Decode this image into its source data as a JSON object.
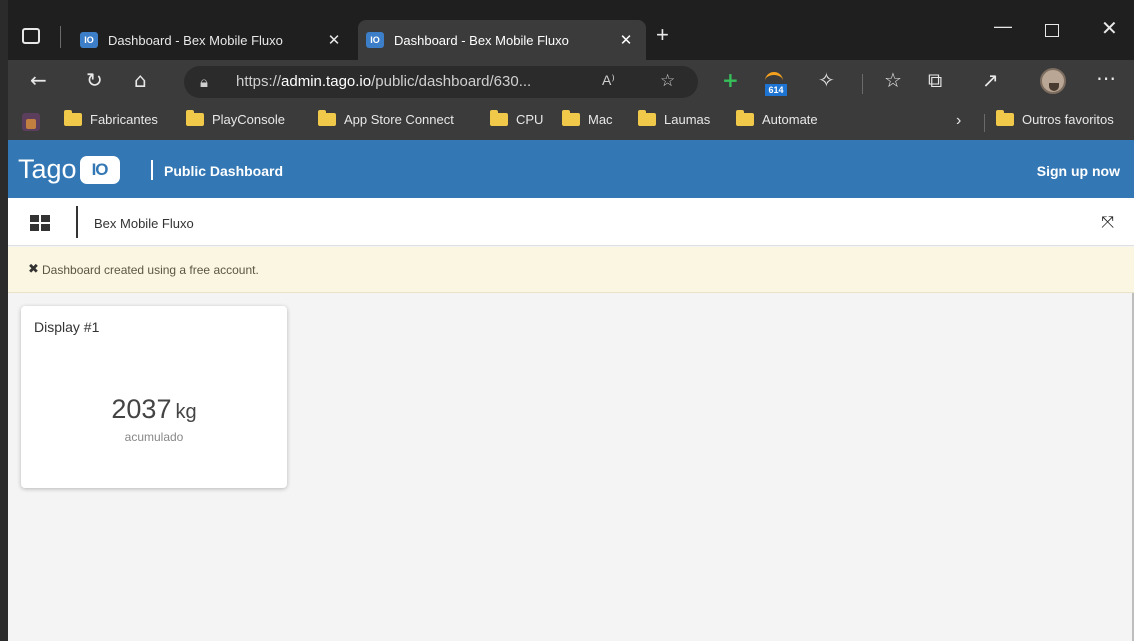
{
  "browser": {
    "tabs": [
      {
        "label": "Dashboard - Bex Mobile Fluxo",
        "favicon": "IO",
        "active": false
      },
      {
        "label": "Dashboard - Bex Mobile Fluxo",
        "favicon": "IO",
        "active": true
      }
    ],
    "close_glyph": "✕",
    "newtab_glyph": "+",
    "address": {
      "url_prefix": "https://",
      "url_host": "admin.tago.io",
      "url_path": "/public/dashboard/630...",
      "read_aloud": "A⁾"
    },
    "extension_badge": "614",
    "bookmarks": [
      "Fabricantes",
      "PlayConsole",
      "App Store Connect",
      "CPU",
      "Mac",
      "Laumas",
      "Automate"
    ],
    "other_favorites": "Outros favoritos"
  },
  "header": {
    "logo_text": "Tago",
    "logo_io": "IO",
    "subtitle": "Public Dashboard",
    "signup": "Sign up now"
  },
  "subbar": {
    "dashboard_name": "Bex Mobile Fluxo"
  },
  "notice": {
    "text": "Dashboard created using a free account."
  },
  "widget": {
    "title": "Display #1",
    "value": "2037",
    "unit": "kg",
    "label": "acumulado"
  },
  "colors": {
    "header": "#3378b5",
    "notice_bg": "#fbf6e1",
    "browser_dark": "#3b3b3b"
  }
}
